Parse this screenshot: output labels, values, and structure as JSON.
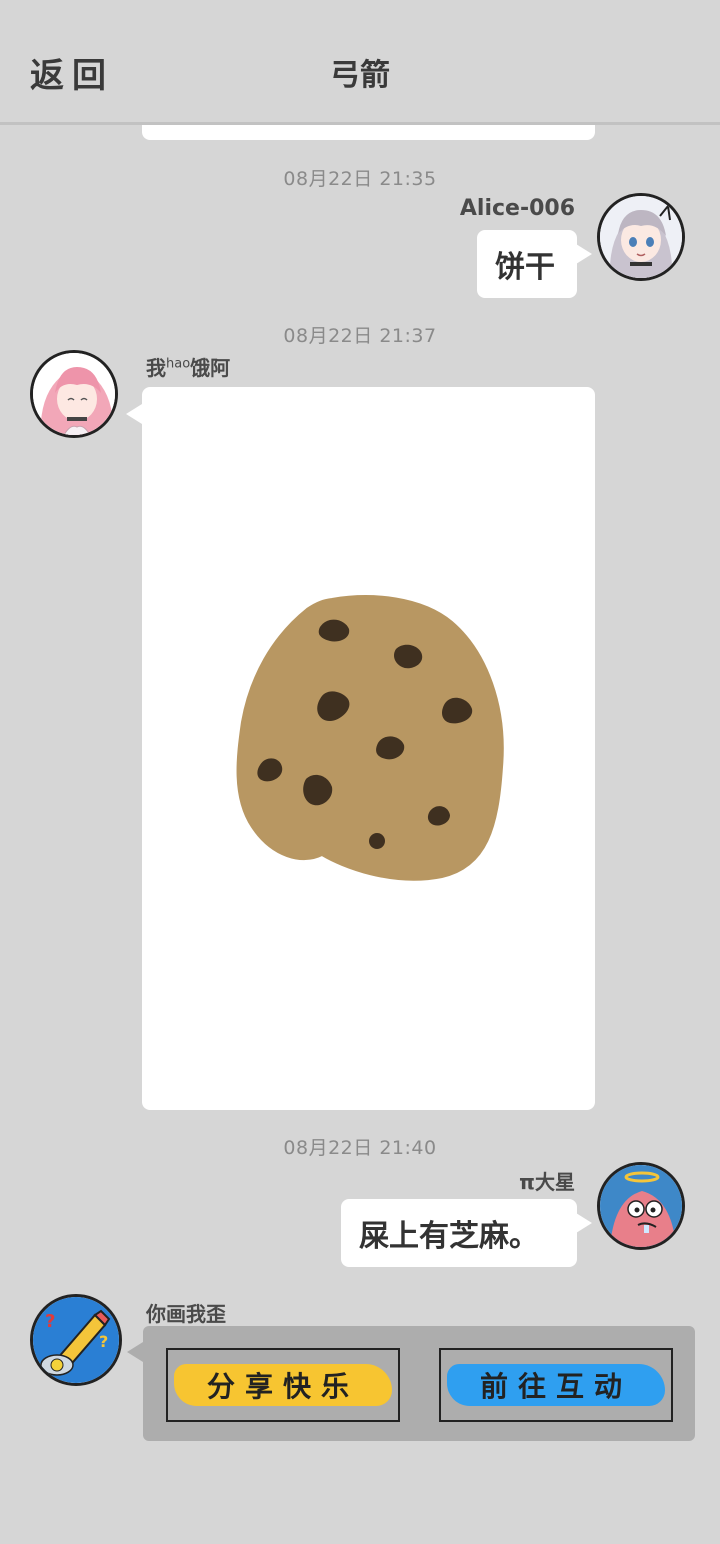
{
  "header": {
    "back_label": "返回",
    "title": "弓箭"
  },
  "messages": [
    {
      "timestamp": "08月22日  21:35",
      "sender": "Alice-006",
      "side": "right",
      "text": "饼干"
    },
    {
      "timestamp": "08月22日  21:37",
      "sender_main": "我",
      "sender_sup": "hao",
      "sender_tail": "饿阿",
      "side": "left",
      "type": "image",
      "image_desc": "cookie-drawing"
    },
    {
      "timestamp": "08月22日  21:40",
      "sender": "π大星",
      "side": "right",
      "text": "屎上有芝麻。"
    },
    {
      "sender": "你画我歪",
      "side": "left",
      "type": "game-card",
      "buttons": [
        {
          "label": "分享快乐",
          "color": "#f7c531"
        },
        {
          "label": "前往互动",
          "color": "#2f9ff0"
        }
      ]
    }
  ],
  "colors": {
    "background": "#d6d6d6",
    "bubble": "#ffffff",
    "cookie": "#b89762",
    "chip": "#3f3020",
    "timestamp": "#8a8a8a"
  }
}
